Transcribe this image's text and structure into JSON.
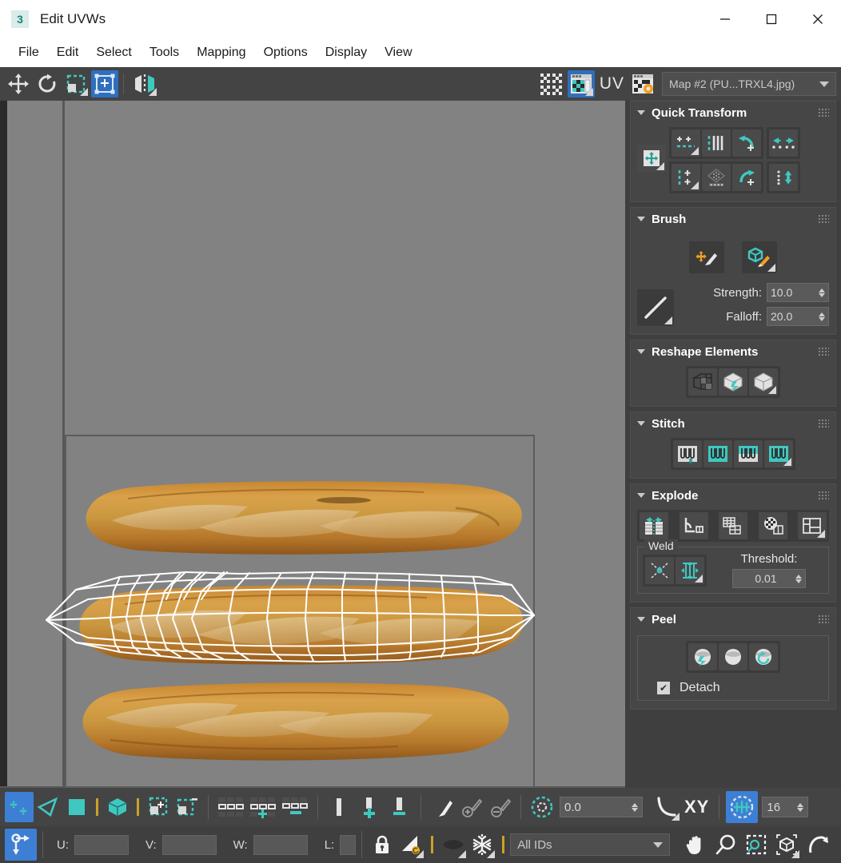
{
  "window": {
    "title": "Edit UVWs",
    "app_icon": "3dsmax-icon",
    "minimize": "minimize-icon",
    "maximize": "maximize-icon",
    "close": "close-icon"
  },
  "menu": {
    "items": [
      {
        "label": "File"
      },
      {
        "label": "Edit"
      },
      {
        "label": "Select"
      },
      {
        "label": "Tools"
      },
      {
        "label": "Mapping"
      },
      {
        "label": "Options"
      },
      {
        "label": "Display"
      },
      {
        "label": "View"
      }
    ]
  },
  "toolbar": {
    "left_tools": [
      {
        "name": "move-tool",
        "icon": "move-icon",
        "active": false,
        "flyout": false
      },
      {
        "name": "rotate-tool",
        "icon": "rotate-icon",
        "active": false,
        "flyout": false
      },
      {
        "name": "scale-tool",
        "icon": "scale-icon",
        "active": false,
        "flyout": true
      },
      {
        "name": "freeform-mode-tool",
        "icon": "freeform-icon",
        "active": true,
        "flyout": false
      },
      {
        "name": "mirror-tool",
        "icon": "mirror-icon",
        "active": false,
        "flyout": true
      }
    ],
    "right_tools": [
      {
        "name": "show-map-checker-tool",
        "icon": "checker-grid-icon",
        "active": false,
        "flyout": false
      },
      {
        "name": "show-map-tool",
        "icon": "show-map-icon",
        "active": true,
        "flyout": true
      }
    ],
    "uv_label": "UV",
    "uv_flyout": true,
    "map_options_icon": "map-options-gear-icon",
    "map_combo": {
      "value": "Map #2 (PU...TRXL4.jpg)",
      "caret": "chevron-down-icon"
    }
  },
  "canvas": {
    "background_color": "#828282",
    "tile_border_color": "#5c5c5c",
    "mesh_color": "#ffffff",
    "texture_label": "baguette-texture",
    "bread_count": 3
  },
  "panels": [
    {
      "id": "quick_transform",
      "title": "Quick Transform",
      "collapse_icon": "triangle-down-icon",
      "grip_icon": "grip-dots-icon"
    },
    {
      "id": "brush",
      "title": "Brush",
      "collapse_icon": "triangle-down-icon",
      "grip_icon": "grip-dots-icon",
      "strength_label": "Strength:",
      "strength_value": "10.0",
      "falloff_label": "Falloff:",
      "falloff_value": "20.0"
    },
    {
      "id": "reshape_elements",
      "title": "Reshape Elements",
      "collapse_icon": "triangle-down-icon",
      "grip_icon": "grip-dots-icon"
    },
    {
      "id": "stitch",
      "title": "Stitch",
      "collapse_icon": "triangle-down-icon",
      "grip_icon": "grip-dots-icon"
    },
    {
      "id": "explode",
      "title": "Explode",
      "collapse_icon": "triangle-down-icon",
      "grip_icon": "grip-dots-icon",
      "weld_legend": "Weld",
      "threshold_label": "Threshold:",
      "threshold_value": "0.01"
    },
    {
      "id": "peel",
      "title": "Peel",
      "collapse_icon": "triangle-down-icon",
      "grip_icon": "grip-dots-icon",
      "detach_label": "Detach",
      "detach_checked": true,
      "check_glyph": "✔"
    }
  ],
  "bottom_toolbar": {
    "sub_object_modes": [
      {
        "name": "vertex-subobject-mode",
        "icon": "vertex-icon",
        "active": true
      },
      {
        "name": "edge-subobject-mode",
        "icon": "edge-icon",
        "active": false
      },
      {
        "name": "face-subobject-mode",
        "icon": "face-icon",
        "active": false
      }
    ],
    "element_mode": {
      "name": "element-subobject-mode",
      "icon": "cube-icon",
      "active": false
    },
    "selection_tools": [
      {
        "name": "grow-selection",
        "icon": "grow-selection-icon"
      },
      {
        "name": "shrink-selection",
        "icon": "shrink-selection-icon"
      }
    ],
    "align_tools": [
      {
        "name": "loop-uv",
        "icon": "loop-uv-icon"
      },
      {
        "name": "loop-uv-grow",
        "icon": "loop-uv-grow-icon"
      },
      {
        "name": "ring-uv",
        "icon": "ring-uv-icon"
      },
      {
        "name": "align-vertical",
        "icon": "align-vertical-icon"
      },
      {
        "name": "align-vertical-grow",
        "icon": "align-vertical-grow-icon"
      },
      {
        "name": "align-horizontal",
        "icon": "align-horizontal-icon"
      }
    ],
    "paint_tools": [
      {
        "name": "paint-select",
        "icon": "paintbrush-icon"
      },
      {
        "name": "paint-select-grow",
        "icon": "brush-plus-icon"
      },
      {
        "name": "paint-select-shrink",
        "icon": "brush-minus-icon"
      }
    ],
    "soft_selection_icon": "soft-selection-icon",
    "falloff_value": "0.0",
    "curve_icon": "falloff-curve-icon",
    "axis_label": "XY",
    "snap_toggle": {
      "name": "snap-toggle",
      "icon": "snap-icon",
      "active": true
    },
    "grid_value": "16"
  },
  "status_bar": {
    "transform_icon": "move-transform-icon",
    "transform_active": true,
    "fields": [
      {
        "label": "U:",
        "value": ""
      },
      {
        "label": "V:",
        "value": ""
      },
      {
        "label": "W:",
        "value": ""
      },
      {
        "label": "L:",
        "value": ""
      }
    ],
    "lock_icon": "lock-icon",
    "prevent_reflatten_icon": "prevent-reflatten-icon",
    "hide_icon": "hide-selected-icon",
    "freeze_icon": "freeze-icon",
    "ids_combo": {
      "value": "All IDs",
      "caret": "chevron-down-icon"
    },
    "view_tools": [
      {
        "name": "pan-tool",
        "icon": "hand-icon"
      },
      {
        "name": "zoom-tool",
        "icon": "magnifier-icon"
      },
      {
        "name": "zoom-region-tool",
        "icon": "zoom-region-icon"
      },
      {
        "name": "zoom-extents-tool",
        "icon": "zoom-extents-icon"
      },
      {
        "name": "zoom-extents-selected-tool",
        "icon": "zoom-extents-selected-icon"
      }
    ]
  },
  "colors": {
    "accent_teal": "#3fc8c0",
    "accent_blue": "#3d7fd4",
    "accent_orange": "#f0a020",
    "panel_bg": "#3f3f3f",
    "rollout_bg": "#464646",
    "canvas_bg": "#828282"
  }
}
